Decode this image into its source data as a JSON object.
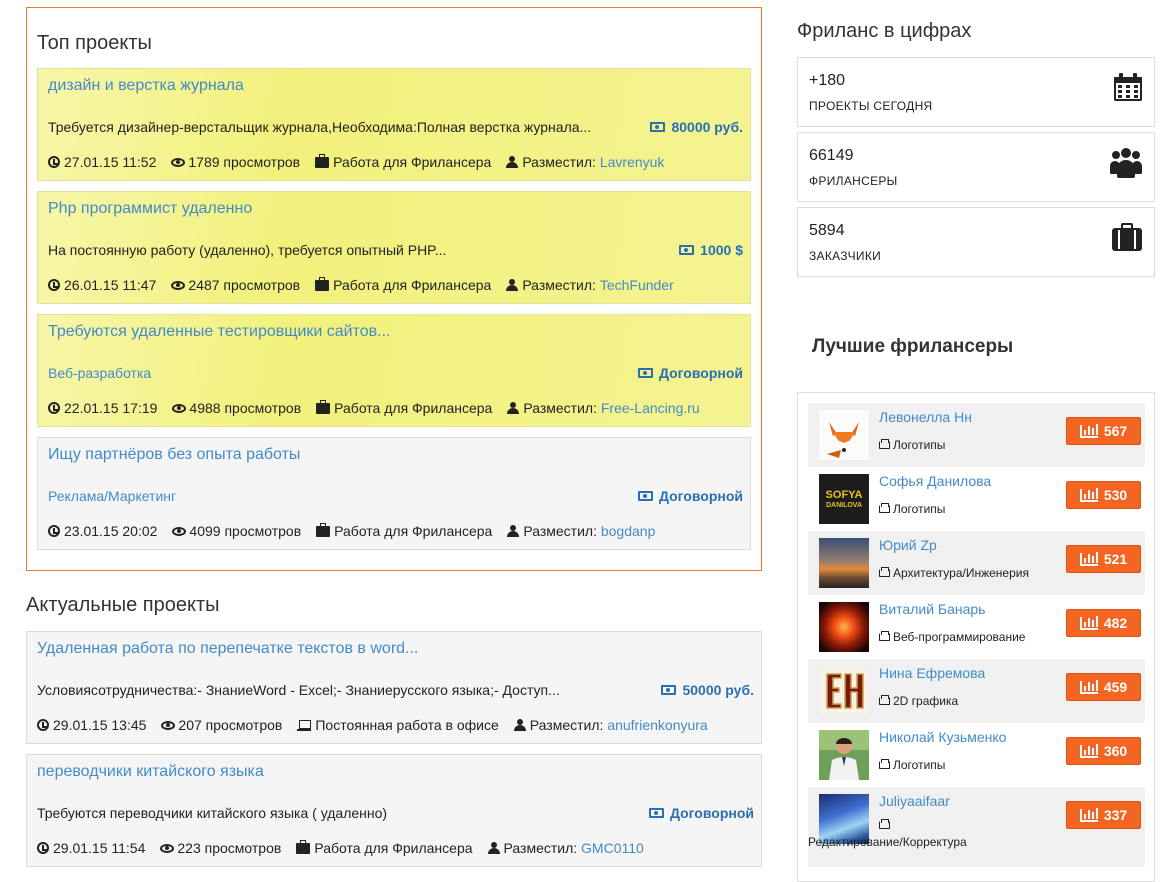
{
  "top_projects": {
    "title": "Топ проекты",
    "items": [
      {
        "title": "дизайн и верстка журнала",
        "desc": "Требуется дизайнер-верстальщик журнала,Необходима:Полная верстка журнала...",
        "price": "80000 руб.",
        "date": "27.01.15 11:52",
        "views": "1789 просмотров",
        "type": "Работа для Фрилансера",
        "author_label": "Разместил:",
        "author": "Lavrenyuk"
      },
      {
        "title": "Php программист удаленно",
        "desc": "На постоянную работу (удаленно), требуется опытный PHP...",
        "price": "1000 $",
        "date": "26.01.15 11:47",
        "views": "2487 просмотров",
        "type": "Работа для Фрилансера",
        "author_label": "Разместил:",
        "author": "TechFunder"
      },
      {
        "title": "Требуются удаленные тестировщики сайтов...",
        "desc": "Веб-разработка",
        "price": "Договорной",
        "date": "22.01.15 17:19",
        "views": "4988 просмотров",
        "type": "Работа для Фрилансера",
        "author_label": "Разместил:",
        "author": "Free-Lancing.ru"
      },
      {
        "title": "Ищу партнёров без опыта работы",
        "desc": "Реклама/Маркетинг",
        "price": "Договорной",
        "date": "23.01.15 20:02",
        "views": "4099 просмотров",
        "type": "Работа для Фрилансера",
        "author_label": "Разместил:",
        "author": "bogdanp"
      }
    ]
  },
  "actual_projects": {
    "title": "Актуальные проекты",
    "items": [
      {
        "title": "Удаленная работа по перепечатке текстов в word...",
        "desc": "Условиясотрудничества:- ЗнаниеWord - Excel;- Знаниерусского языка;- Доступ...",
        "price": "50000 руб.",
        "date": "29.01.15 13:45",
        "views": "207 просмотров",
        "type": "Постоянная работа в офисе",
        "author_label": "Разместил:",
        "author": "anufrienkonyura"
      },
      {
        "title": "переводчики китайского языка",
        "desc": "Требуются переводчики китайского языка ( удаленно)",
        "price": "Договорной",
        "date": "29.01.15 11:54",
        "views": "223 просмотров",
        "type": "Работа для Фрилансера",
        "author_label": "Разместил:",
        "author": "GMC0110"
      }
    ]
  },
  "stats": {
    "title": "Фриланс в цифрах",
    "items": [
      {
        "value": "+180",
        "label": "ПРОЕКТЫ СЕГОДНЯ",
        "icon": "calendar-icon"
      },
      {
        "value": "66149",
        "label": "ФРИЛАНСЕРЫ",
        "icon": "users-icon"
      },
      {
        "value": "5894",
        "label": "ЗАКАЗЧИКИ",
        "icon": "briefcase-icon"
      }
    ]
  },
  "best": {
    "title": "Лучшие фрилансеры",
    "items": [
      {
        "name": "Левонелла Нн",
        "category": "Логотипы",
        "rating": "567"
      },
      {
        "name": "Софья Данилова",
        "category": "Логотипы",
        "rating": "530",
        "avatar_text_1": "SOFYA",
        "avatar_text_2": "DANILOVA"
      },
      {
        "name": "Юрий Zp",
        "category": "Архитектура/Инженерия",
        "rating": "521"
      },
      {
        "name": "Виталий Банарь",
        "category": "Веб-программирование",
        "rating": "482"
      },
      {
        "name": "Нина Ефремова",
        "category": "2D графика",
        "rating": "459"
      },
      {
        "name": "Николай Кузьменко",
        "category": "Логотипы",
        "rating": "360"
      },
      {
        "name": "Juliyaaifaar",
        "category": "Редактирование/Корректура",
        "rating": "337"
      }
    ]
  },
  "colors": {
    "accent_orange": "#f26522",
    "link_blue": "#428bca",
    "highlight_yellow": "#f2f17c"
  }
}
